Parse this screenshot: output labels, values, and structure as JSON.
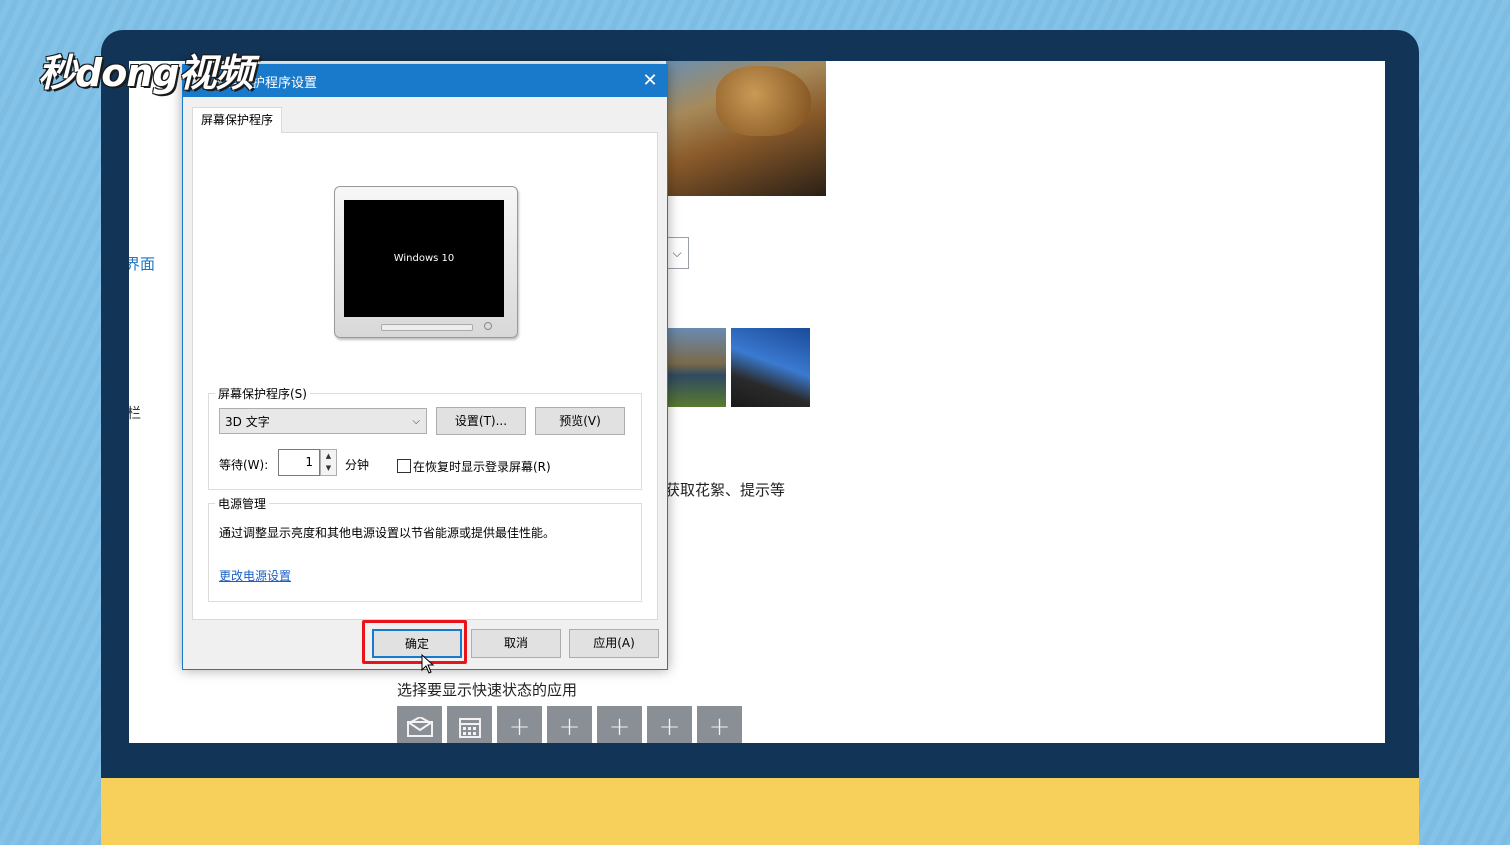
{
  "watermark": {
    "text": "秒dong视频"
  },
  "background_page": {
    "left_link": "界面",
    "left_item": "栏",
    "partial_text": "获取花絮、提示等",
    "quick_status_label": "选择要显示快速状态的应用",
    "quick_tiles": [
      "mail-icon",
      "calendar-icon",
      "+",
      "+",
      "+",
      "+",
      "+"
    ]
  },
  "dialog": {
    "title": "屏幕保护程序设置",
    "close_symbol": "✕",
    "tab_label": "屏幕保护程序",
    "preview_text": "Windows 10",
    "saver_group": {
      "label": "屏幕保护程序(S)",
      "selected": "3D 文字",
      "settings_button": "设置(T)...",
      "preview_button": "预览(V)",
      "wait_label": "等待(W):",
      "wait_value": "1",
      "minutes_label": "分钟",
      "checkbox_label": "在恢复时显示登录屏幕(R)",
      "checkbox_checked": false
    },
    "power_group": {
      "label": "电源管理",
      "description": "通过调整显示亮度和其他电源设置以节省能源或提供最佳性能。",
      "link": "更改电源设置"
    },
    "buttons": {
      "ok": "确定",
      "cancel": "取消",
      "apply": "应用(A)"
    }
  },
  "colors": {
    "accent": "#1979ca",
    "highlight": "#e8141a",
    "frame": "#123456",
    "base": "#f7cf5b"
  }
}
